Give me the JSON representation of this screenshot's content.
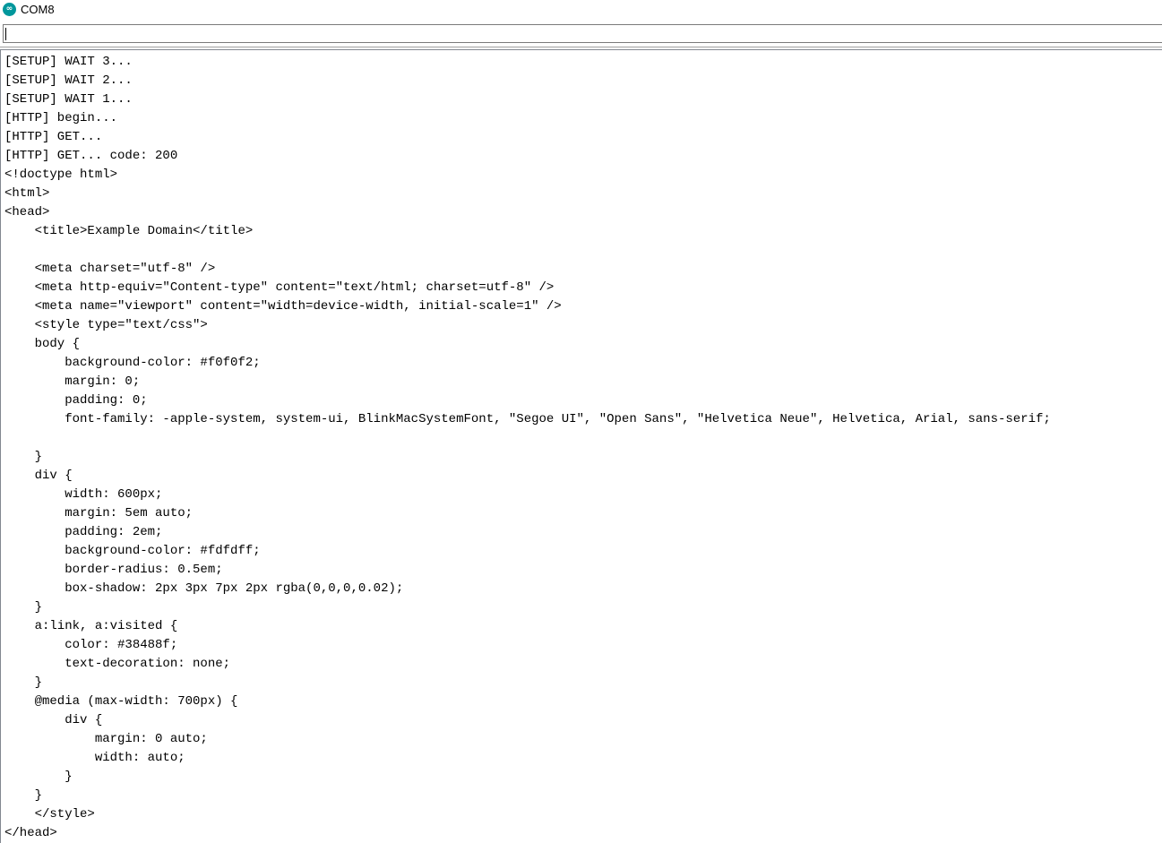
{
  "window": {
    "title": "COM8",
    "icon": "arduino-logo-icon"
  },
  "input": {
    "value": "",
    "placeholder": ""
  },
  "output": {
    "lines": [
      "[SETUP] WAIT 3...",
      "[SETUP] WAIT 2...",
      "[SETUP] WAIT 1...",
      "[HTTP] begin...",
      "[HTTP] GET...",
      "[HTTP] GET... code: 200",
      "<!doctype html>",
      "<html>",
      "<head>",
      "    <title>Example Domain</title>",
      "",
      "    <meta charset=\"utf-8\" />",
      "    <meta http-equiv=\"Content-type\" content=\"text/html; charset=utf-8\" />",
      "    <meta name=\"viewport\" content=\"width=device-width, initial-scale=1\" />",
      "    <style type=\"text/css\">",
      "    body {",
      "        background-color: #f0f0f2;",
      "        margin: 0;",
      "        padding: 0;",
      "        font-family: -apple-system, system-ui, BlinkMacSystemFont, \"Segoe UI\", \"Open Sans\", \"Helvetica Neue\", Helvetica, Arial, sans-serif;",
      "",
      "    }",
      "    div {",
      "        width: 600px;",
      "        margin: 5em auto;",
      "        padding: 2em;",
      "        background-color: #fdfdff;",
      "        border-radius: 0.5em;",
      "        box-shadow: 2px 3px 7px 2px rgba(0,0,0,0.02);",
      "    }",
      "    a:link, a:visited {",
      "        color: #38488f;",
      "        text-decoration: none;",
      "    }",
      "    @media (max-width: 700px) {",
      "        div {",
      "            margin: 0 auto;",
      "            width: auto;",
      "        }",
      "    }",
      "    </style>",
      "</head>"
    ]
  }
}
